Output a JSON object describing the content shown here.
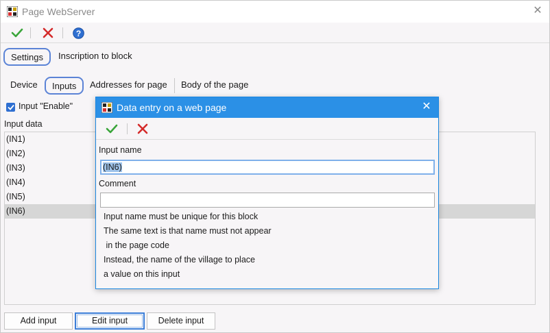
{
  "window": {
    "title": "Page WebServer"
  },
  "top_tabs": [
    {
      "label": "Settings",
      "active": true
    },
    {
      "label": "Inscription to block",
      "active": false
    }
  ],
  "sub_tabs": [
    {
      "label": "Device",
      "active": false
    },
    {
      "label": "Inputs",
      "active": true
    },
    {
      "label": "Addresses for page",
      "active": false
    },
    {
      "label": "Body of the page",
      "active": false
    }
  ],
  "enable_checkbox": {
    "label": "Input \"Enable\"",
    "checked": true
  },
  "input_data": {
    "header": "Input data",
    "items": [
      "(IN1)",
      "(IN2)",
      "(IN3)",
      "(IN4)",
      "(IN5)",
      "(IN6)"
    ],
    "selected_index": 5
  },
  "buttons": {
    "add": "Add input",
    "edit": "Edit input",
    "delete": "Delete input"
  },
  "dialog": {
    "title": "Data entry on a web page",
    "input_name_label": "Input name",
    "input_name_value": "(IN6)",
    "comment_label": "Comment",
    "comment_value": "",
    "hints": [
      "Input name must be unique for this block",
      "The same text is that name must not appear",
      " in the page code",
      "Instead, the name of the village to place",
      "a value on this input"
    ]
  },
  "colors": {
    "accept": "#3aa53a",
    "cancel": "#d42a2a",
    "help": "#2f6fd1",
    "dialog_title": "#2b90e6",
    "selection": "#9fc3ea"
  }
}
